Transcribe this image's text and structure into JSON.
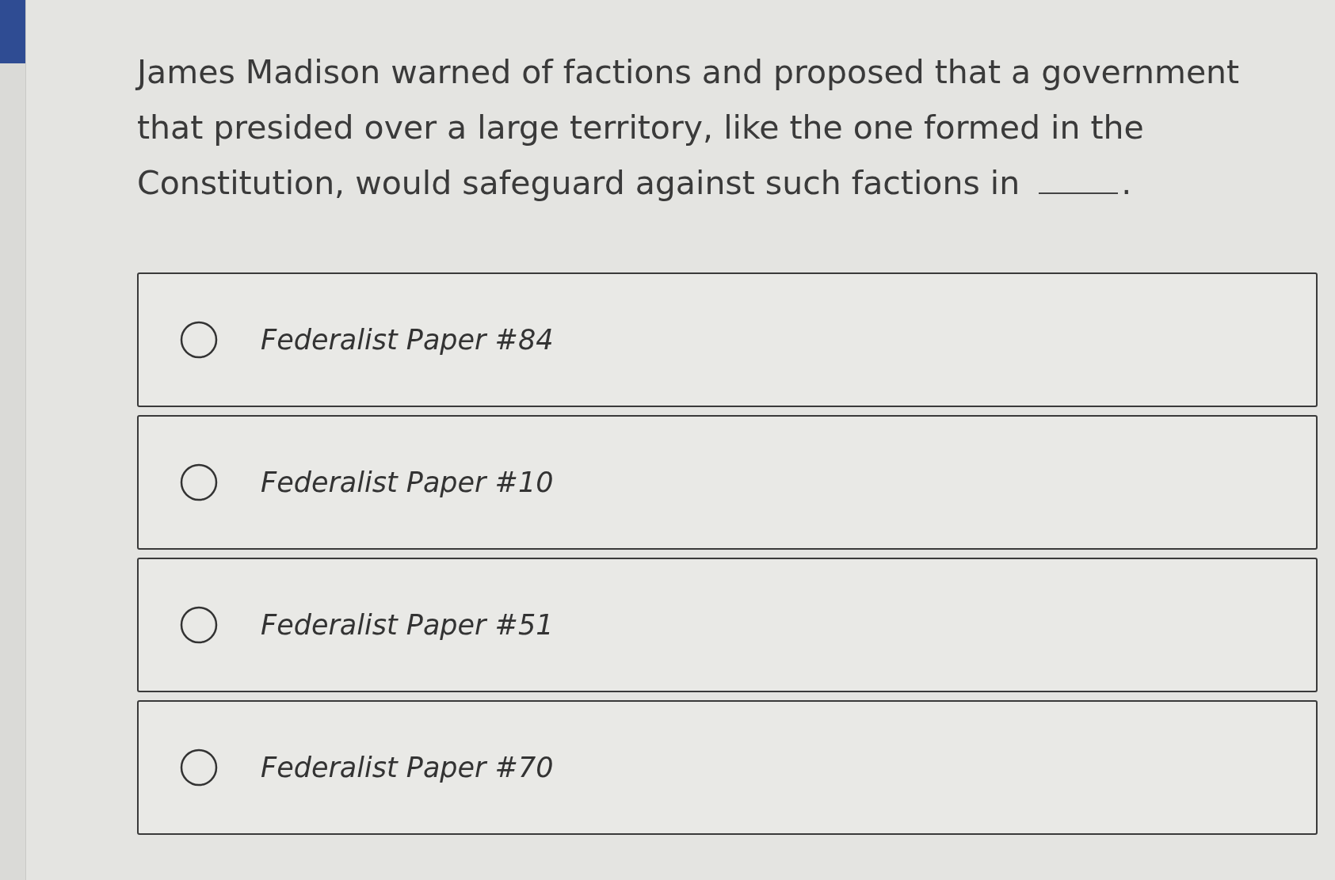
{
  "question": {
    "text": "James Madison warned of factions and proposed that a government that presided over a large territory, like the one formed in the Constitution, would safeguard against such factions in",
    "ending": "."
  },
  "options": [
    {
      "label": "Federalist Paper #84",
      "selected": false
    },
    {
      "label": "Federalist Paper #10",
      "selected": false
    },
    {
      "label": "Federalist Paper #51",
      "selected": false
    },
    {
      "label": "Federalist Paper #70",
      "selected": false
    }
  ]
}
